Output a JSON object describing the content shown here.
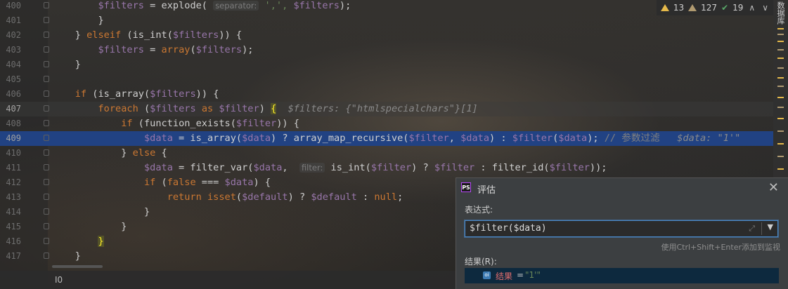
{
  "editor": {
    "lines": [
      {
        "num": "400",
        "segments": [
          [
            "        ",
            "punc"
          ],
          [
            "$filters",
            "var"
          ],
          [
            " = explode( ",
            "punc"
          ],
          [
            "separator:",
            "hint"
          ],
          [
            " ',', ",
            "str"
          ],
          [
            "$filters",
            "var"
          ],
          [
            ");",
            "punc"
          ]
        ]
      },
      {
        "num": "401",
        "segments": [
          [
            "        }",
            "punc"
          ]
        ]
      },
      {
        "num": "402",
        "segments": [
          [
            "    } ",
            "punc"
          ],
          [
            "elseif",
            "kw"
          ],
          [
            " (is_int(",
            "punc"
          ],
          [
            "$filters",
            "var"
          ],
          [
            ")) {",
            "punc"
          ]
        ]
      },
      {
        "num": "403",
        "segments": [
          [
            "        ",
            "punc"
          ],
          [
            "$filters",
            "var"
          ],
          [
            " = ",
            "punc"
          ],
          [
            "array",
            "kw"
          ],
          [
            "(",
            "punc"
          ],
          [
            "$filters",
            "var"
          ],
          [
            ");",
            "punc"
          ]
        ]
      },
      {
        "num": "404",
        "segments": [
          [
            "    }",
            "punc"
          ]
        ]
      },
      {
        "num": "405",
        "segments": [
          [
            "",
            "punc"
          ]
        ]
      },
      {
        "num": "406",
        "segments": [
          [
            "    ",
            "punc"
          ],
          [
            "if",
            "kw"
          ],
          [
            " (is_array(",
            "punc"
          ],
          [
            "$filters",
            "var"
          ],
          [
            ")) {",
            "punc"
          ]
        ]
      },
      {
        "num": "407",
        "segments": [
          [
            "        ",
            "punc"
          ],
          [
            "foreach",
            "kw"
          ],
          [
            " (",
            "punc"
          ],
          [
            "$filters",
            "var"
          ],
          [
            " as ",
            "kw"
          ],
          [
            "$filter",
            "var"
          ],
          [
            ") ",
            "punc"
          ],
          [
            "{",
            "brace-hl"
          ],
          [
            "  ",
            "punc"
          ],
          [
            "$filters: {\"htmlspecialchars\"}[1]",
            "inline-val"
          ]
        ]
      },
      {
        "num": "408",
        "segments": [
          [
            "            ",
            "punc"
          ],
          [
            "if",
            "kw"
          ],
          [
            " (function_exists(",
            "punc"
          ],
          [
            "$filter",
            "var"
          ],
          [
            ")) {",
            "punc"
          ]
        ]
      },
      {
        "num": "409",
        "segments": [
          [
            "                ",
            "punc"
          ],
          [
            "$data",
            "var"
          ],
          [
            " = is_array(",
            "punc"
          ],
          [
            "$data",
            "var"
          ],
          [
            ") ? array_map_recursive(",
            "punc"
          ],
          [
            "$filter",
            "var"
          ],
          [
            ", ",
            "punc"
          ],
          [
            "$data",
            "var"
          ],
          [
            ") : ",
            "punc"
          ],
          [
            "$filter",
            "var"
          ],
          [
            "(",
            "punc"
          ],
          [
            "$data",
            "var"
          ],
          [
            ");",
            "punc"
          ],
          [
            " // 参数过滤   ",
            "cm"
          ],
          [
            "$data: \"1'\"",
            "inline-val"
          ]
        ]
      },
      {
        "num": "410",
        "segments": [
          [
            "            } ",
            "punc"
          ],
          [
            "else",
            "kw"
          ],
          [
            " {",
            "punc"
          ]
        ]
      },
      {
        "num": "411",
        "segments": [
          [
            "                ",
            "punc"
          ],
          [
            "$data",
            "var"
          ],
          [
            " = filter_var(",
            "punc"
          ],
          [
            "$data",
            "var"
          ],
          [
            ",  ",
            "punc"
          ],
          [
            "filter:",
            "hint"
          ],
          [
            " is_int(",
            "punc"
          ],
          [
            "$filter",
            "var"
          ],
          [
            ") ? ",
            "punc"
          ],
          [
            "$filter",
            "var"
          ],
          [
            " : filter_id(",
            "punc"
          ],
          [
            "$filter",
            "var"
          ],
          [
            "));",
            "punc"
          ]
        ]
      },
      {
        "num": "412",
        "segments": [
          [
            "                ",
            "punc"
          ],
          [
            "if",
            "kw"
          ],
          [
            " (",
            "punc"
          ],
          [
            "false",
            "kw"
          ],
          [
            " === ",
            "punc"
          ],
          [
            "$data",
            "var"
          ],
          [
            ") {",
            "punc"
          ]
        ]
      },
      {
        "num": "413",
        "segments": [
          [
            "                    ",
            "punc"
          ],
          [
            "return",
            "kw"
          ],
          [
            " ",
            "punc"
          ],
          [
            "isset",
            "kw"
          ],
          [
            "(",
            "punc"
          ],
          [
            "$default",
            "var"
          ],
          [
            ") ? ",
            "punc"
          ],
          [
            "$default",
            "var"
          ],
          [
            " : ",
            "punc"
          ],
          [
            "null",
            "kw"
          ],
          [
            ";",
            "punc"
          ]
        ]
      },
      {
        "num": "414",
        "segments": [
          [
            "                }",
            "punc"
          ]
        ]
      },
      {
        "num": "415",
        "segments": [
          [
            "            }",
            "punc"
          ]
        ]
      },
      {
        "num": "416",
        "segments": [
          [
            "        ",
            "punc"
          ],
          [
            "}",
            "brace-hl"
          ]
        ]
      },
      {
        "num": "417",
        "segments": [
          [
            "    }",
            "punc"
          ]
        ]
      }
    ],
    "current_line": "407",
    "execution_line": "409"
  },
  "inspections": {
    "errors": "13",
    "warnings": "127",
    "ok": "19"
  },
  "right_tab": "数据库",
  "status_bar": {
    "text": "I0"
  },
  "evaluate_dialog": {
    "title": "评估",
    "logo": "PS",
    "expression_label": "表达式:",
    "expression": "$filter($data)",
    "hint": "使用Ctrl+Shift+Enter添加到监视",
    "result_label": "结果(R):",
    "result": {
      "badge": "oi",
      "name": "结果",
      "equals": "=",
      "value": "\"1'\""
    }
  },
  "colors": {
    "execution_highlight": "#214283",
    "keyword": "#cc7832",
    "variable": "#9876aa",
    "string": "#6a8759"
  }
}
